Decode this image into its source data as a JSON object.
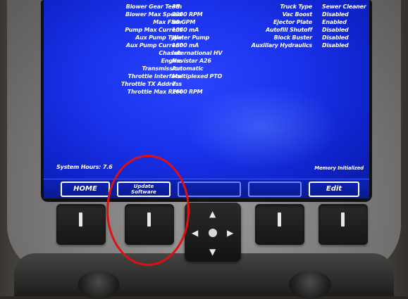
{
  "left_labels": [
    "Blower Gear Teeth",
    "Blower Max Speed",
    "Max Flow",
    "Pump Max Current",
    "Aux Pump Type",
    "Aux Pump Current",
    "Chassis",
    "Engine",
    "Transmission",
    "Throttle Interface",
    "Throttle TX Address",
    "Throttle Max RPM"
  ],
  "left_values": [
    "38",
    "2200 RPM",
    "90 GPM",
    "1040 mA",
    "Water Pump",
    "1600 mA",
    "International HV",
    "Navistar A26",
    "Automatic",
    "Multiplexed PTO",
    "7",
    "1600 RPM"
  ],
  "right_labels": [
    "Truck Type",
    "Vac Boost",
    "Ejector Plate",
    "Autofill Shutoff",
    "Block Buster",
    "Auxiliary Hydraulics"
  ],
  "right_values": [
    "Sewer Cleaner",
    "Disabled",
    "Enabled",
    "Disabled",
    "Disabled",
    "Disabled"
  ],
  "status": {
    "system_hours": "System Hours: 7.6",
    "memory": "Memory Initialized"
  },
  "softkeys": {
    "home": "HOME",
    "update_line1": "Update",
    "update_line2": "Software",
    "edit": "Edit"
  },
  "colors": {
    "screen_blue": "#1a34ee",
    "highlight_red": "#e01010"
  },
  "dpad_icons": [
    "arrow-up-icon",
    "arrow-down-icon",
    "arrow-left-icon",
    "arrow-right-icon",
    "center-dot-icon"
  ]
}
